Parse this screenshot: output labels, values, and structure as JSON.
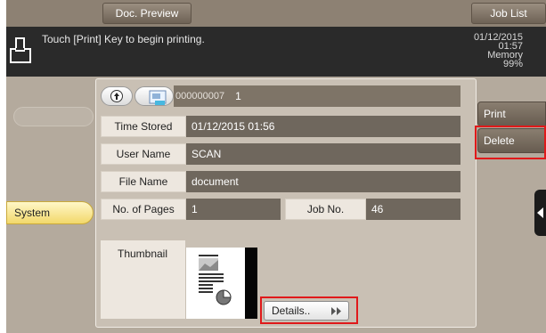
{
  "header": {
    "doc_preview_tab": "Doc. Preview",
    "job_list_tab": "Job List"
  },
  "message_bar": {
    "message": "Touch [Print] Key to begin printing.",
    "date": "01/12/2015",
    "time": "01:57",
    "memory_label": "Memory",
    "memory_value": "99%",
    "icon": "printer-icon"
  },
  "left_nav": {
    "system_tab": "System"
  },
  "document": {
    "number": "000000007",
    "count": "1",
    "fields": {
      "time_stored_label": "Time Stored",
      "time_stored_value": "01/12/2015 01:56",
      "user_name_label": "User Name",
      "user_name_value": "SCAN",
      "file_name_label": "File Name",
      "file_name_value": "document",
      "pages_label": "No. of Pages",
      "pages_value": "1",
      "job_no_label": "Job No.",
      "job_no_value": "46"
    },
    "thumbnail_label": "Thumbnail",
    "details_button": "Details.."
  },
  "side_actions": {
    "print": "Print",
    "delete": "Delete"
  },
  "colors": {
    "highlight_frame": "#e0191a",
    "system_tab": "#f2d86b"
  }
}
